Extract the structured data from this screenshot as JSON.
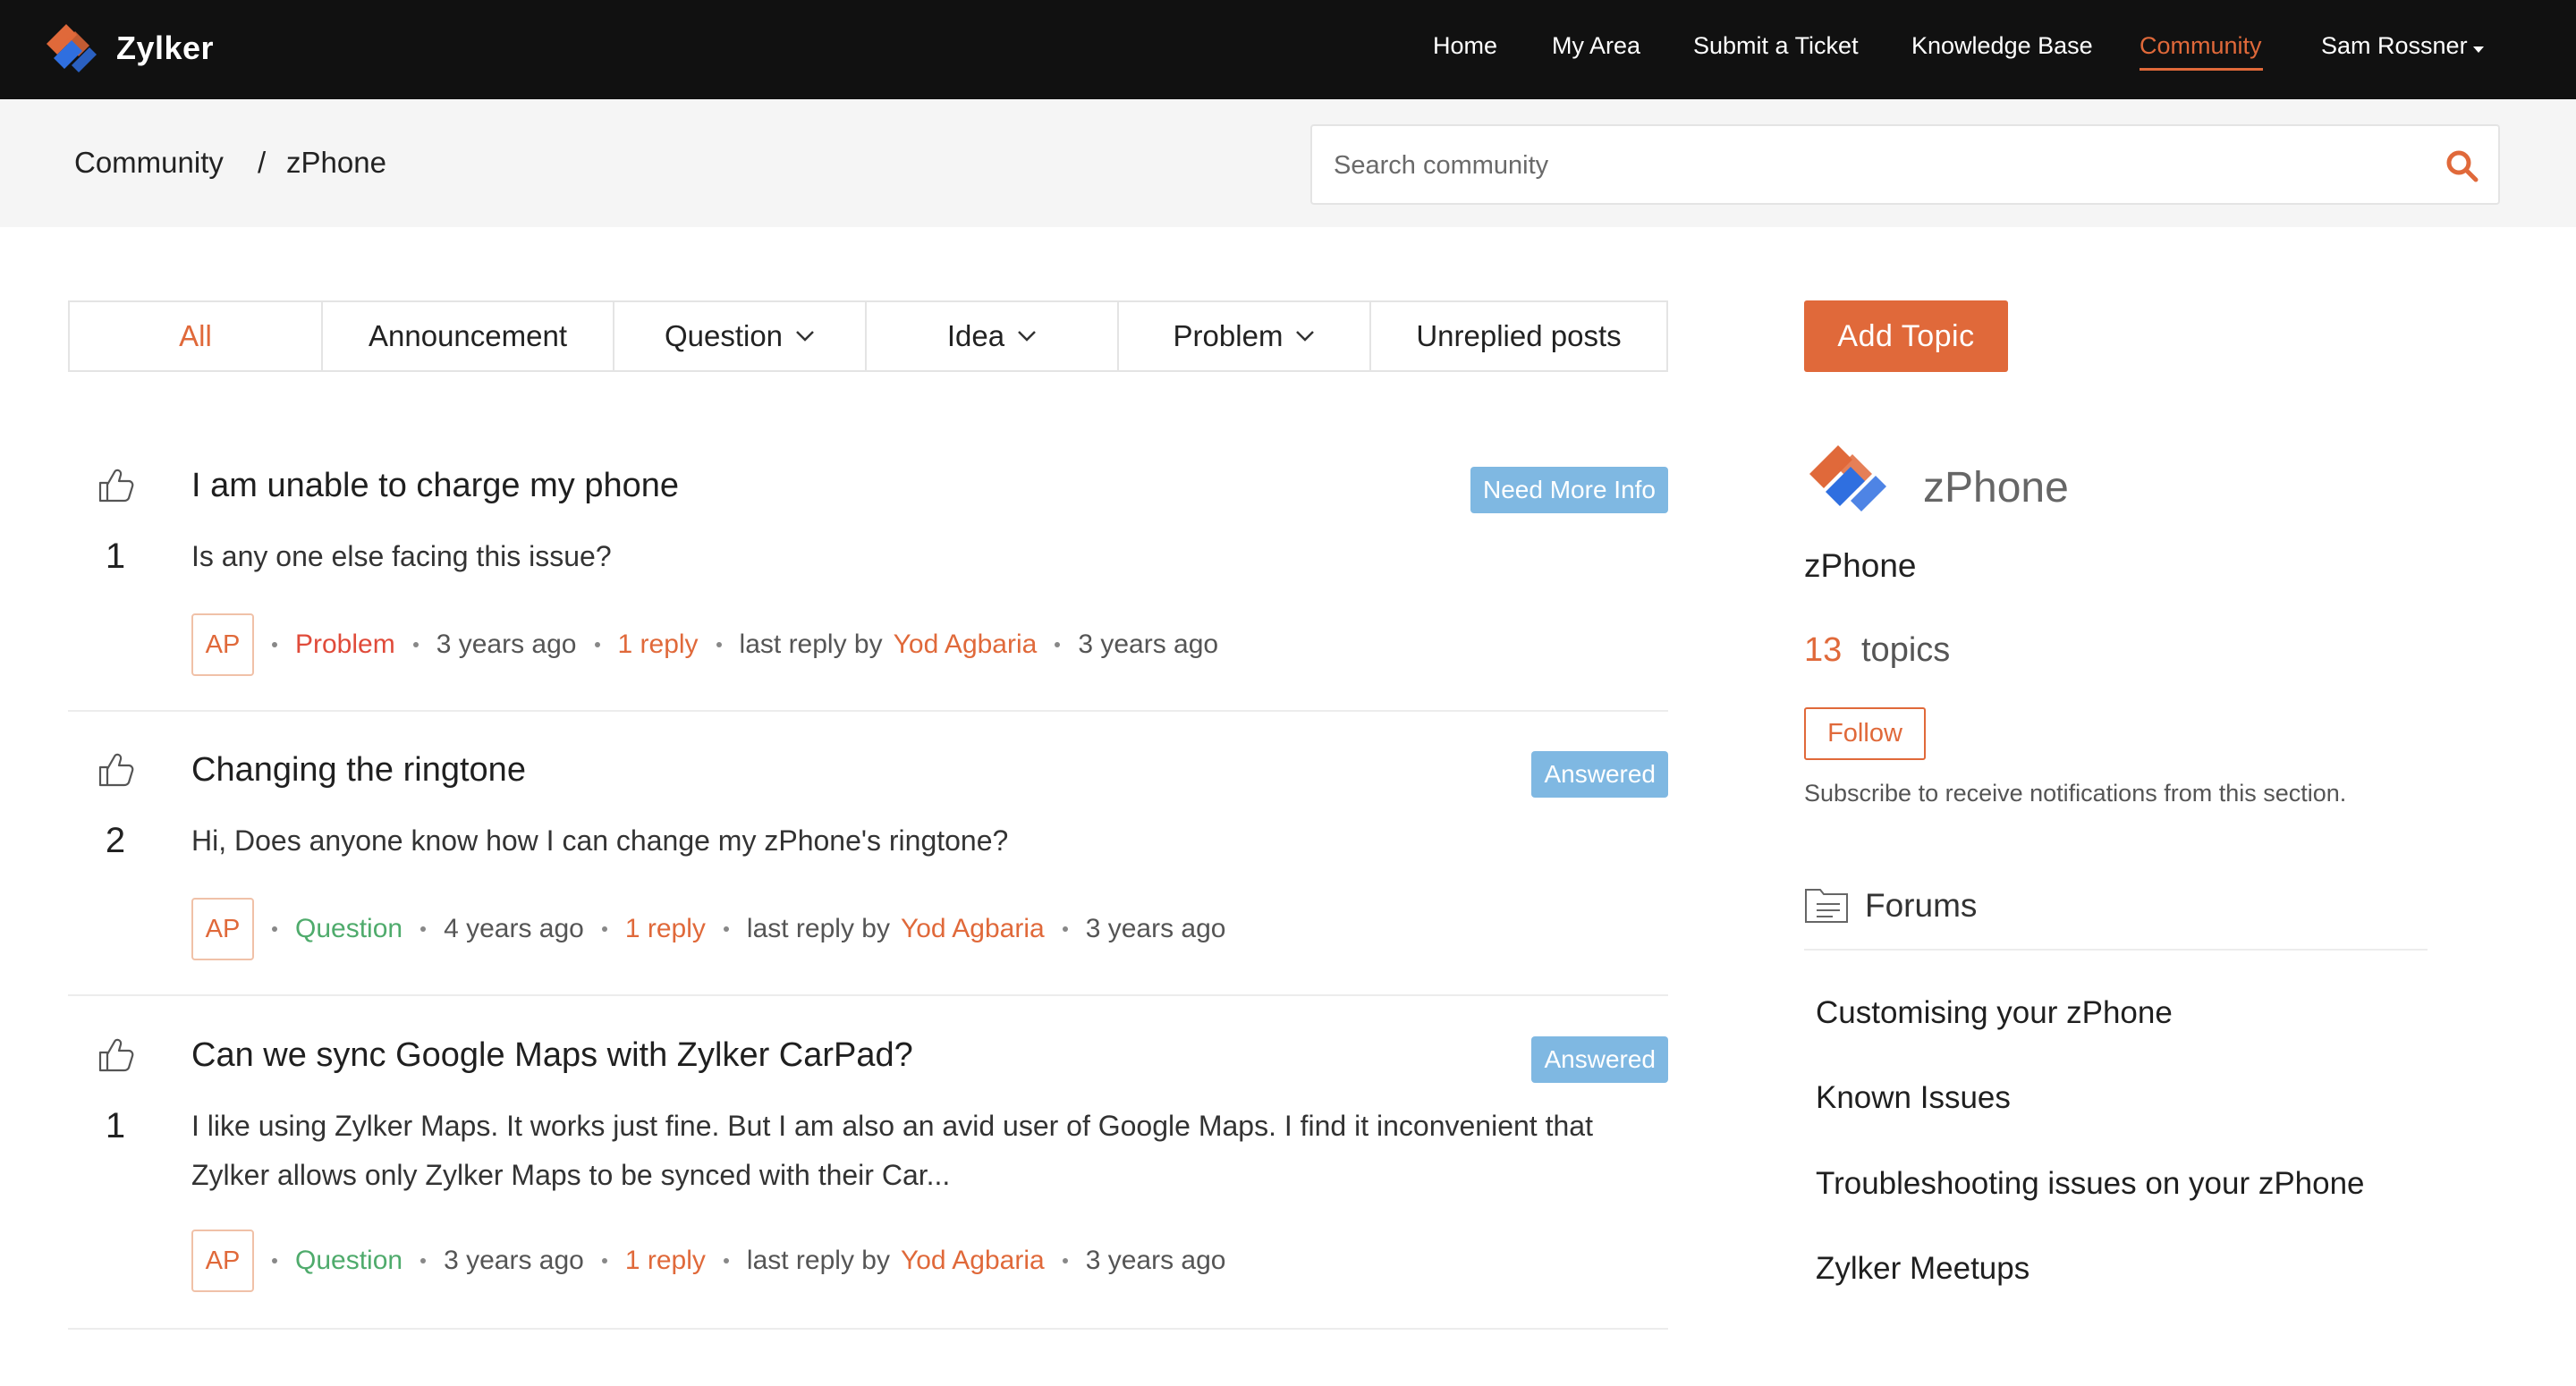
{
  "header": {
    "brand": "Zylker",
    "nav": [
      {
        "label": "Home"
      },
      {
        "label": "My Area"
      },
      {
        "label": "Submit a Ticket"
      },
      {
        "label": "Knowledge Base"
      },
      {
        "label": "Community",
        "active": true
      }
    ],
    "user": "Sam Rossner"
  },
  "breadcrumb": {
    "root": "Community",
    "separator": "/",
    "current": "zPhone"
  },
  "search": {
    "placeholder": "Search community"
  },
  "tabs": [
    {
      "label": "All",
      "active": true
    },
    {
      "label": "Announcement"
    },
    {
      "label": "Question",
      "dropdown": true
    },
    {
      "label": "Idea",
      "dropdown": true
    },
    {
      "label": "Problem",
      "dropdown": true
    },
    {
      "label": "Unreplied posts"
    }
  ],
  "topics": [
    {
      "votes": "1",
      "title": "I am unable to charge my phone",
      "body": "Is any one else facing this issue?",
      "status": "Need More Info",
      "avatar": "AP",
      "category": "Problem",
      "posted": "3 years ago",
      "replies": "1 reply",
      "last_reply_label": "last reply by",
      "last_reply_by": "Yod Agbaria",
      "last_reply_time": "3 years ago"
    },
    {
      "votes": "2",
      "title": "Changing the ringtone",
      "body": "Hi, Does anyone know how I can change my zPhone's ringtone?",
      "status": "Answered",
      "avatar": "AP",
      "category": "Question",
      "posted": "4 years ago",
      "replies": "1 reply",
      "last_reply_label": "last reply by",
      "last_reply_by": "Yod Agbaria",
      "last_reply_time": "3 years ago"
    },
    {
      "votes": "1",
      "title": "Can we sync Google Maps with Zylker CarPad?",
      "body": "I like using Zylker Maps. It works just fine. But I am also an avid user of Google Maps. I find it inconvenient that Zylker allows only Zylker Maps to be synced with their Car...",
      "status": "Answered",
      "avatar": "AP",
      "category": "Question",
      "posted": "3 years ago",
      "replies": "1 reply",
      "last_reply_label": "last reply by",
      "last_reply_by": "Yod Agbaria",
      "last_reply_time": "3 years ago"
    }
  ],
  "sidebar": {
    "add_topic": "Add Topic",
    "logo_text": "zPhone",
    "section_name": "zPhone",
    "topic_count": "13",
    "topic_label": "topics",
    "follow": "Follow",
    "follow_note": "Subscribe to receive notifications from this section.",
    "forums_title": "Forums",
    "forums": [
      {
        "label": "Customising your zPhone"
      },
      {
        "label": "Known Issues"
      },
      {
        "label": "Troubleshooting issues on your zPhone"
      },
      {
        "label": "Zylker Meetups"
      }
    ]
  },
  "colors": {
    "accent": "#e0693a",
    "topbar": "#111111",
    "status_badge": "#7fb8e2",
    "problem": "#e04b3a",
    "question": "#4fab6c"
  }
}
